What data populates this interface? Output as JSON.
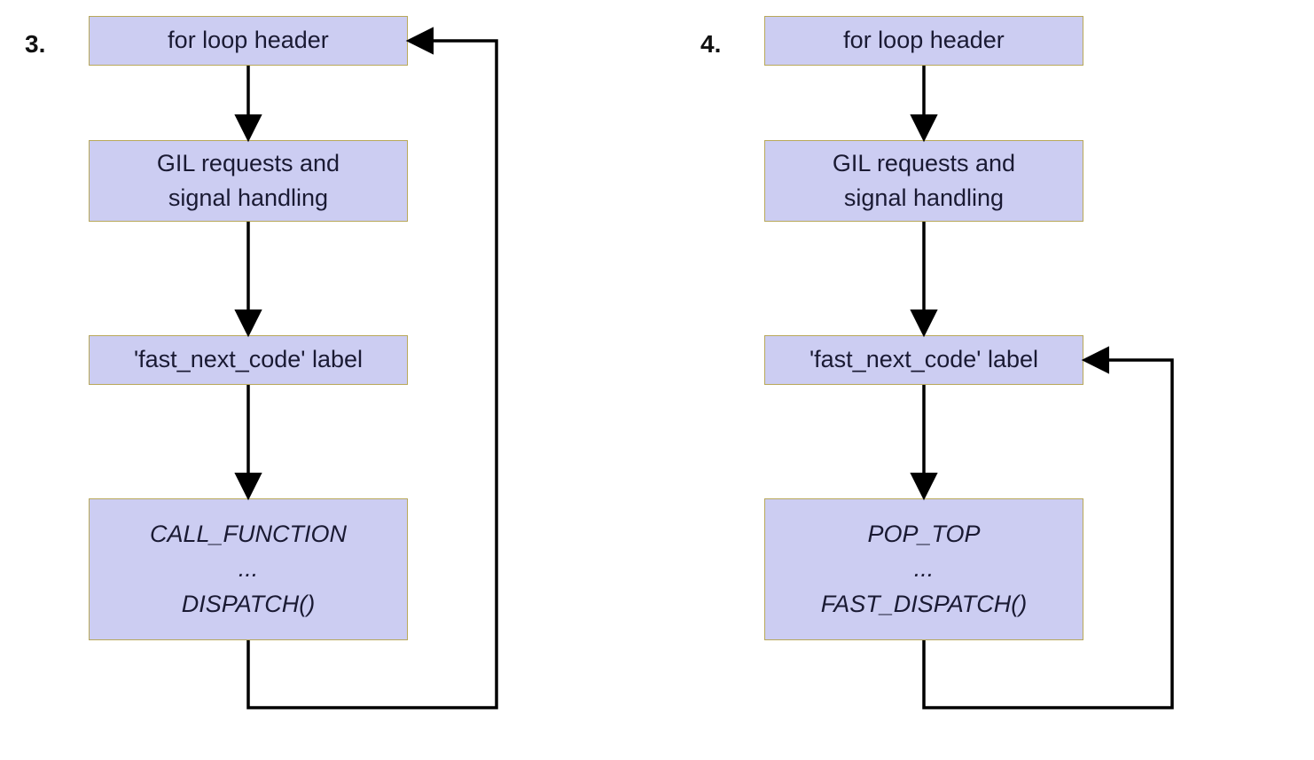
{
  "diagrams": [
    {
      "number": "3.",
      "boxes": {
        "b1": {
          "lines": [
            "for loop header"
          ]
        },
        "b2": {
          "lines": [
            "GIL requests and",
            "signal handling"
          ]
        },
        "b3": {
          "lines": [
            "'fast_next_code' label"
          ]
        },
        "b4": {
          "lines": [
            "CALL_FUNCTION",
            "...",
            "DISPATCH()"
          ],
          "italic": true
        }
      },
      "loop_target": "b1"
    },
    {
      "number": "4.",
      "boxes": {
        "b1": {
          "lines": [
            "for loop header"
          ]
        },
        "b2": {
          "lines": [
            "GIL requests and",
            "signal handling"
          ]
        },
        "b3": {
          "lines": [
            "'fast_next_code' label"
          ]
        },
        "b4": {
          "lines": [
            "POP_TOP",
            "...",
            "FAST_DISPATCH()"
          ],
          "italic": true
        }
      },
      "loop_target": "b3"
    }
  ]
}
